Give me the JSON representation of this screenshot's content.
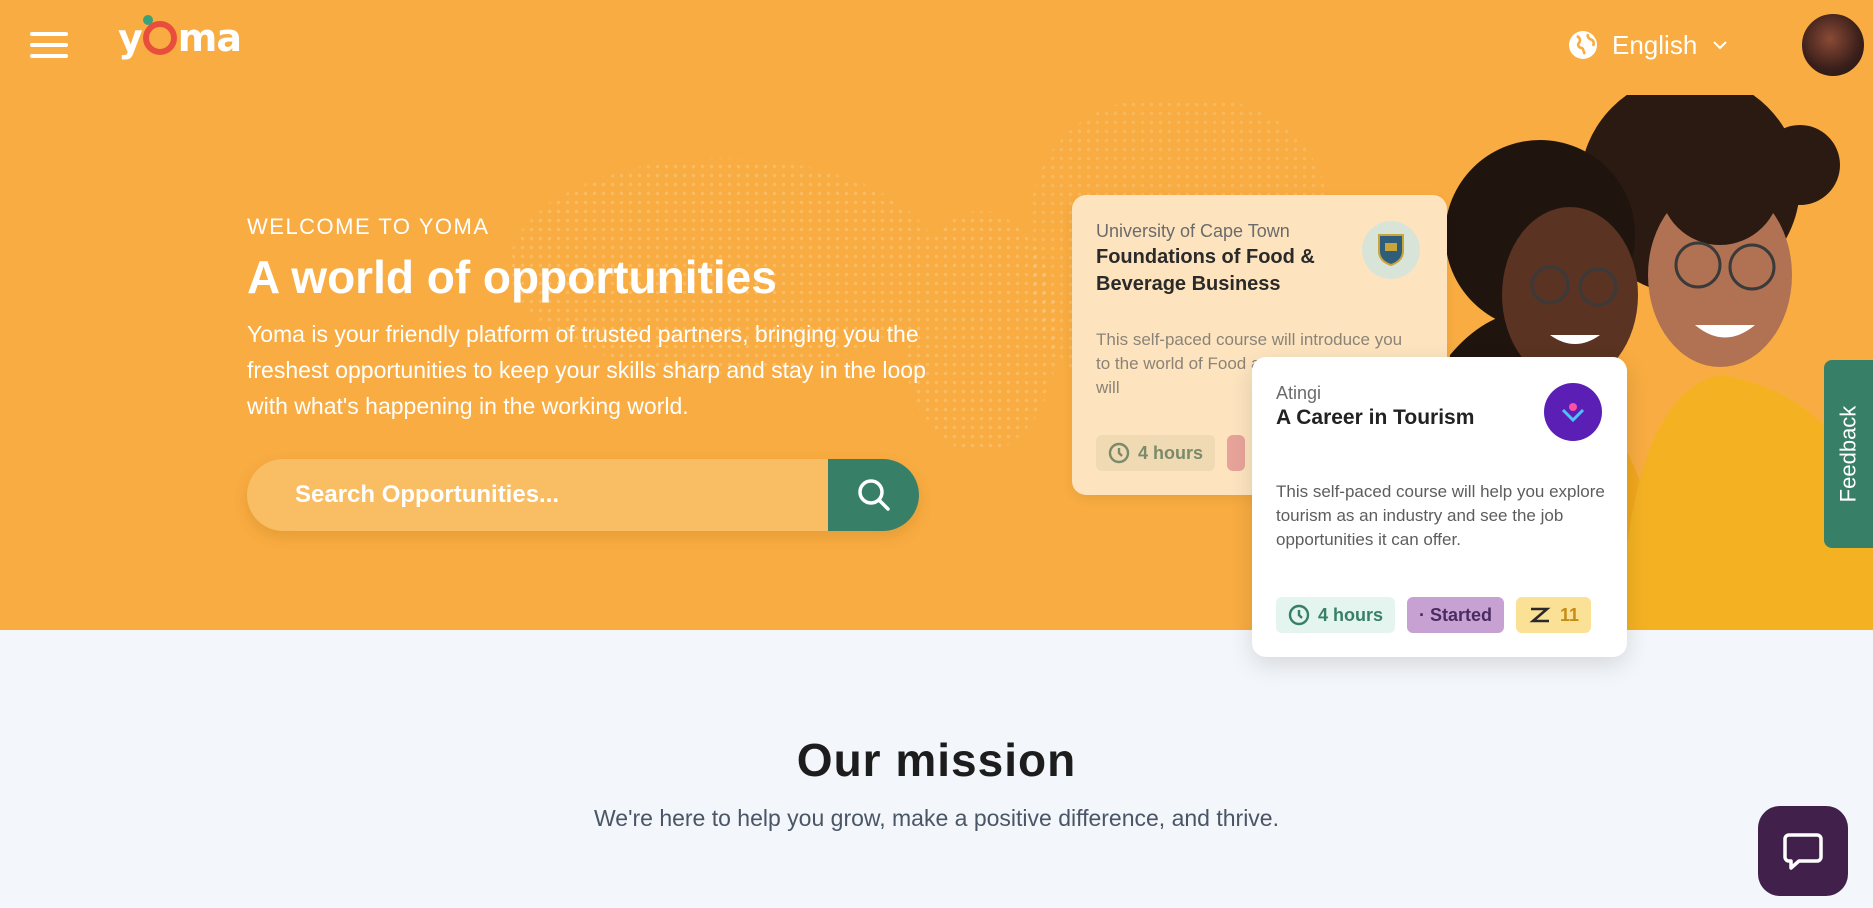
{
  "header": {
    "menu_icon": "hamburger-icon",
    "logo_text": "yoma",
    "language": {
      "label": "English",
      "icon": "globe-icon"
    }
  },
  "hero": {
    "eyebrow": "WELCOME TO YOMA",
    "title": "A world of opportunities",
    "description": "Yoma is your friendly platform of trusted partners, bringing you the freshest opportunities to keep your skills sharp and stay in the loop with what's happening in the working world.",
    "search": {
      "placeholder": "Search Opportunities...",
      "icon": "search-icon"
    }
  },
  "cards": [
    {
      "organisation": "University of Cape Town",
      "title": "Foundations of Food & Beverage Business",
      "description": "This self-paced course will introduce you to the world of Food and Beverage. You will",
      "time": "4 hours"
    },
    {
      "organisation": "Atingi",
      "title": "A Career in Tourism",
      "description": "This self-paced course will help you explore tourism as an industry and see the job opportunities it can offer.",
      "time": "4 hours",
      "status": "· Started",
      "reward": "11"
    }
  ],
  "feedback_label": "Feedback",
  "mission": {
    "title": "Our mission",
    "subtitle": "We're here to help you grow, make a positive difference, and thrive."
  },
  "colors": {
    "hero_bg": "#f8ac41",
    "accent_green": "#387f68",
    "chat_bg": "#41204b"
  }
}
